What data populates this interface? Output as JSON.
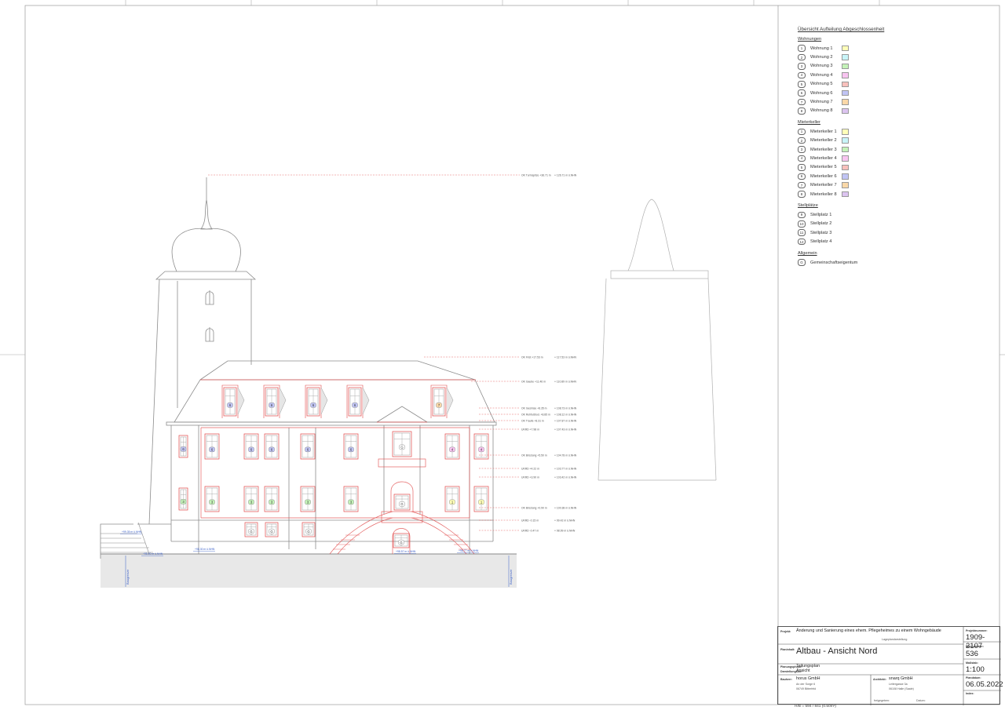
{
  "legend": {
    "title": "Übersicht Aufteilung Abgeschlossenheit",
    "groups": [
      {
        "heading": "Wohnungen",
        "items": [
          {
            "num": "1",
            "label": "Wohnung 1",
            "color": "#ffffb8"
          },
          {
            "num": "2",
            "label": "Wohnung 2",
            "color": "#c8f4f8"
          },
          {
            "num": "3",
            "label": "Wohnung 3",
            "color": "#c4f2b8"
          },
          {
            "num": "4",
            "label": "Wohnung 4",
            "color": "#f8c4f0"
          },
          {
            "num": "5",
            "label": "Wohnung 5",
            "color": "#f8c0bc"
          },
          {
            "num": "6",
            "label": "Wohnung 6",
            "color": "#c0c4f4"
          },
          {
            "num": "7",
            "label": "Wohnung 7",
            "color": "#fad8a8"
          },
          {
            "num": "8",
            "label": "Wohnung 8",
            "color": "#dcc4f0"
          }
        ]
      },
      {
        "heading": "Mieterkeller",
        "items": [
          {
            "num": "1",
            "label": "Mieterkeller 1",
            "color": "#ffffb8"
          },
          {
            "num": "2",
            "label": "Mieterkeller 2",
            "color": "#c8f4f8"
          },
          {
            "num": "3",
            "label": "Mieterkeller 3",
            "color": "#c4f2b8"
          },
          {
            "num": "4",
            "label": "Mieterkeller 4",
            "color": "#f8c4f0"
          },
          {
            "num": "5",
            "label": "Mieterkeller 5",
            "color": "#f8c0bc"
          },
          {
            "num": "6",
            "label": "Mieterkeller 6",
            "color": "#c0c4f4"
          },
          {
            "num": "7",
            "label": "Mieterkeller 7",
            "color": "#fad8a8"
          },
          {
            "num": "8",
            "label": "Mieterkeller 8",
            "color": "#dcc4f0"
          }
        ]
      },
      {
        "heading": "Stellplätze",
        "items": [
          {
            "num": "9",
            "label": "Stellplatz 1",
            "color": ""
          },
          {
            "num": "10",
            "label": "Stellplatz 2",
            "color": ""
          },
          {
            "num": "11",
            "label": "Stellplatz 3",
            "color": ""
          },
          {
            "num": "12",
            "label": "Stellplatz 4",
            "color": ""
          }
        ]
      },
      {
        "heading": "Allgemein",
        "items": [
          {
            "num": "G",
            "label": "Gemeinschaftseigentum",
            "color": ""
          }
        ]
      }
    ]
  },
  "titleblock": {
    "project_label": "Projekt:",
    "project_value": "Änderung und Sanierung eines ehem. Pflegeheimes zu einem Wohngebäude",
    "project_sub": "Lageplandarstellung",
    "plan_label": "Planinhalt:",
    "plan_value": "Altbau - Ansicht Nord",
    "plantype_label": "Planungsphase:",
    "plantype_value": "Teilungsplan",
    "view_label": "Darstellungsart:",
    "view_value": "Ansicht",
    "owner_label": "Bauherr:",
    "owner_name": "horus GmbH",
    "owner_addr1": "An der Sorge 6",
    "owner_addr2": "06749 Bitterfeld",
    "architect_label": "Architekt:",
    "architect_name": "snarq GmbH",
    "architect_addr1": "Leitergasse 3a",
    "architect_addr2": "06108 Halle (Saale)",
    "approved_label": "freigegeben:",
    "date_label": "Datum:",
    "projnum_label": "Projektnummer:",
    "projnum_value": "1909-2107",
    "plannum_label": "Plannummer:",
    "plannum_value": "536",
    "scale_label": "Maßstab:",
    "scale_value": "1:100",
    "plandate_label": "Plandatum:",
    "plandate_value": "06.05.2022",
    "index_label": "Index:",
    "index_value": "",
    "sheet_size": "H/B = 594 / 841 (0.50m²)"
  },
  "elevations": [
    {
      "label": "OK Turmspitze +36.71 m",
      "value": "+ 126.71 m ü.NHN"
    },
    {
      "label": "OK First +17.53 m",
      "value": "+ 117.53 m ü.NHN"
    },
    {
      "label": "OK Gaube +11.46 m",
      "value": "+ 110.89 m ü.NHN"
    },
    {
      "label": "OK Gesimse +8.35 m",
      "value": "+ 108.73 m ü.NHN"
    },
    {
      "label": "OK Rohfußbod. +8.85 m",
      "value": "+ 108.12 m ü.NHN"
    },
    {
      "label": "OK Traufe +8.31 m",
      "value": "+ 107.87 m ü.NHN"
    },
    {
      "label": "UKRD +7.98 m",
      "value": "+ 107.43 m ü.NHN"
    },
    {
      "label": "OK Brüstung +5.50 m",
      "value": "+ 104.78 m ü.NHN"
    },
    {
      "label": "UKRD +4.22 m",
      "value": "+ 103.77 m ü.NHN"
    },
    {
      "label": "UKRD +3.90 m",
      "value": "+ 103.42 m ü.NHN"
    },
    {
      "label": "OK Brüstung +0.90 m",
      "value": "+ 100.38 m ü.NHN"
    },
    {
      "label": "UKRD -0.15 m",
      "value": "+ 99.42 m ü.NHN"
    },
    {
      "label": "UKRD -0.47 m",
      "value": "+ 98.99 m ü.NHN"
    }
  ],
  "ground_levels": [
    {
      "value": "+99.35 m ü.NHN"
    },
    {
      "value": "+98.50 m ü.NHN"
    },
    {
      "value": "+98.30 m ü.NHN"
    },
    {
      "value": "+98.57 m ü.NHN"
    },
    {
      "value": "+98.77 m ü.NHN"
    }
  ],
  "boundary_label": "Baugrenze",
  "window_tags": {
    "dormers": [
      "6",
      "6",
      "6",
      "6",
      "7"
    ],
    "upper": [
      "6",
      "6",
      "6",
      "6",
      "6",
      "6",
      "4",
      "4"
    ],
    "upper_tower": "6",
    "center_upper": "G",
    "lower": [
      "3",
      "3",
      "3",
      "3",
      "3",
      "3",
      "1",
      "1"
    ],
    "lower_tower": "3",
    "center_lower": "G",
    "basement": [
      "G",
      "G",
      "G"
    ],
    "center_basement": "G"
  },
  "colors": {
    "line": "#8c8c8c",
    "red": "#e04848",
    "blue": "#3a5fc8",
    "w1": "#ffffb8",
    "w3": "#c4f2b8",
    "w4": "#f8c4f0",
    "w6": "#c0c4f4",
    "w7": "#fad8a8"
  }
}
